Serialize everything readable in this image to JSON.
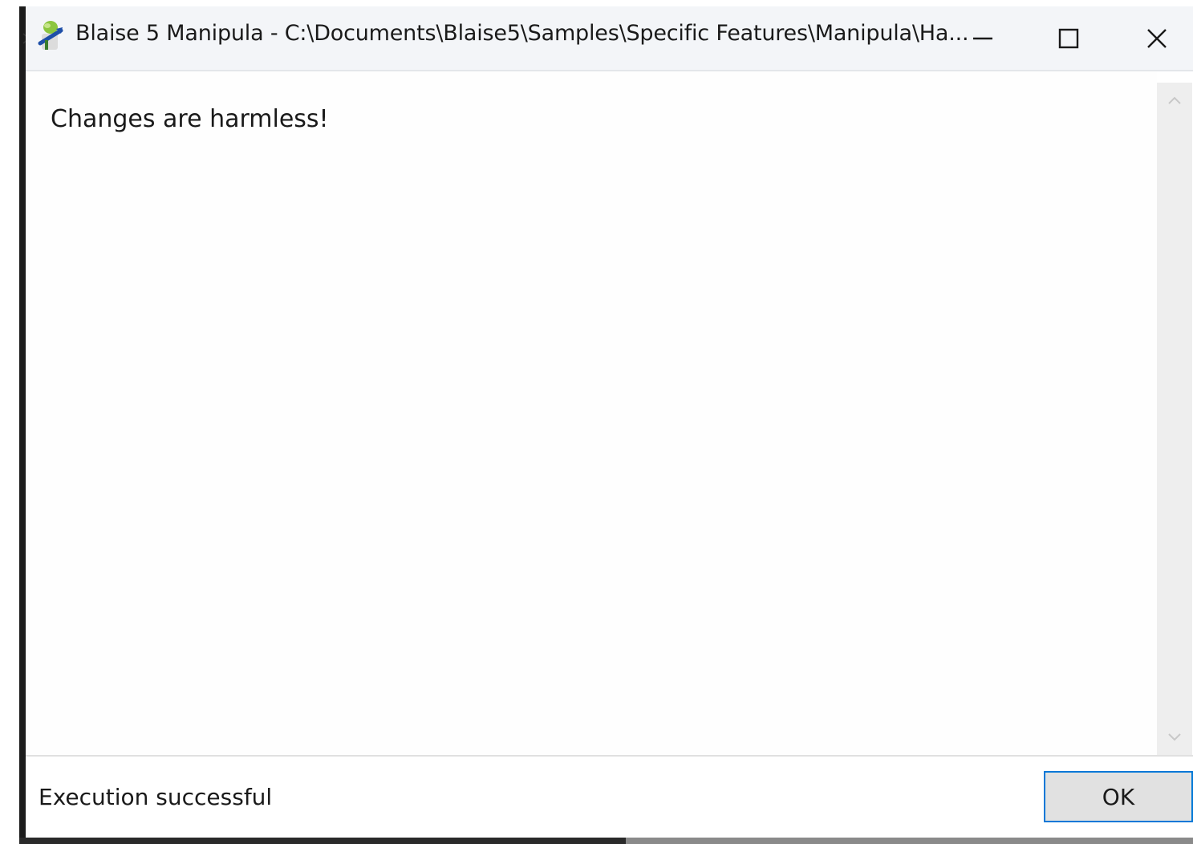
{
  "window": {
    "title": "Blaise 5 Manipula - C:\\Documents\\Blaise5\\Samples\\Specific Features\\Manipula\\Ha...",
    "app_icon": "blaise-manipula-icon",
    "controls": {
      "minimize_icon": "minimize-icon",
      "maximize_icon": "maximize-icon",
      "close_icon": "close-icon"
    }
  },
  "content": {
    "message": "Changes are harmless!"
  },
  "scrollbar": {
    "up_icon": "chevron-up-icon",
    "down_icon": "chevron-down-icon"
  },
  "footer": {
    "status": "Execution successful",
    "ok_label": "OK"
  },
  "colors": {
    "titlebar_bg": "#f3f5f8",
    "button_border": "#0078d7",
    "button_bg": "#e1e1e1",
    "scrollbar_bg": "#eeeeee"
  }
}
